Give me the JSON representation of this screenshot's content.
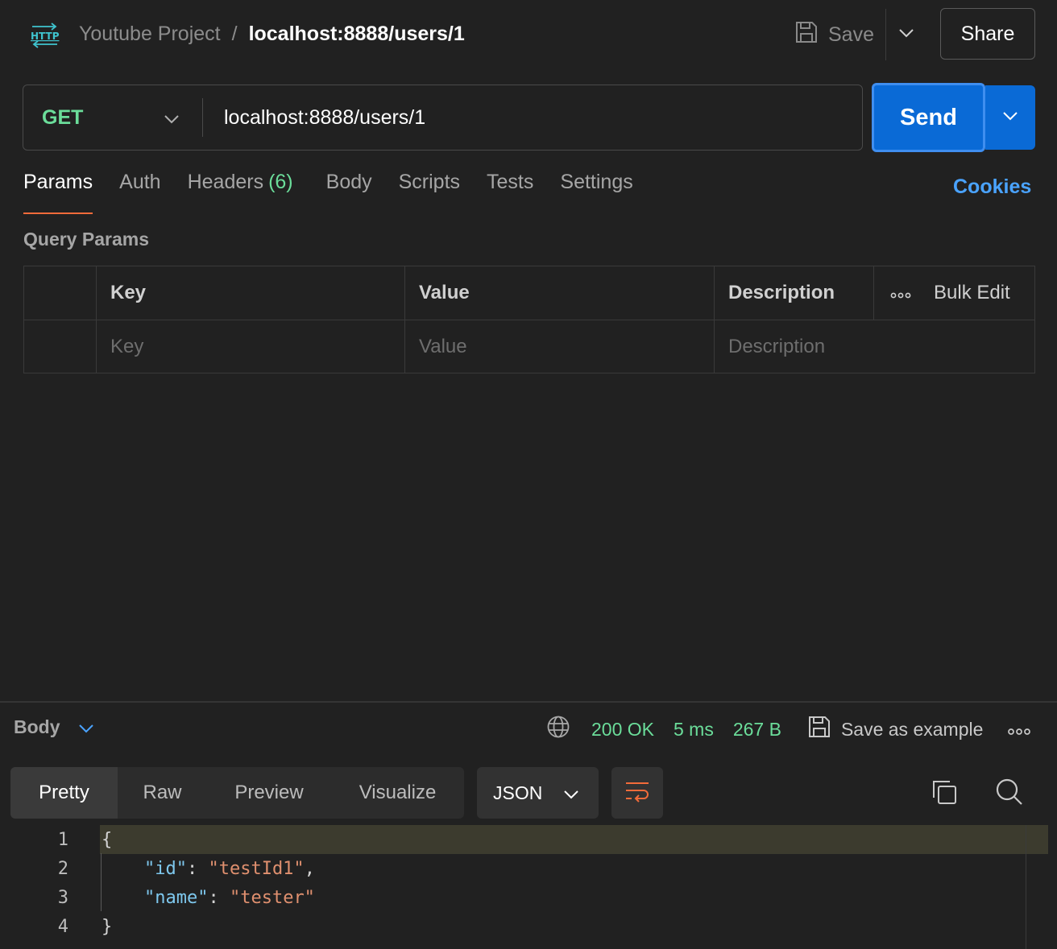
{
  "header": {
    "icon": "http-icon",
    "project": "Youtube Project",
    "separator": "/",
    "request_name": "localhost:8888/users/1",
    "save_label": "Save",
    "share_label": "Share"
  },
  "request": {
    "method": "GET",
    "url": "localhost:8888/users/1",
    "send_label": "Send"
  },
  "tabs": {
    "items": [
      {
        "label": "Params",
        "active": true
      },
      {
        "label": "Auth"
      },
      {
        "label": "Headers",
        "count": "(6)"
      },
      {
        "label": "Body"
      },
      {
        "label": "Scripts"
      },
      {
        "label": "Tests"
      },
      {
        "label": "Settings"
      }
    ],
    "cookies_label": "Cookies"
  },
  "params": {
    "title": "Query Params",
    "columns": {
      "key": "Key",
      "value": "Value",
      "description": "Description"
    },
    "bulk_edit": "Bulk Edit",
    "placeholders": {
      "key": "Key",
      "value": "Value",
      "description": "Description"
    }
  },
  "response": {
    "body_label": "Body",
    "status": "200 OK",
    "time": "5 ms",
    "size": "267 B",
    "save_example": "Save as example",
    "view_tabs": [
      "Pretty",
      "Raw",
      "Preview",
      "Visualize"
    ],
    "active_view": "Pretty",
    "format": "JSON",
    "code": {
      "line_numbers": [
        "1",
        "2",
        "3",
        "4"
      ],
      "open_brace": "{",
      "close_brace": "}",
      "fields": [
        {
          "key": "\"id\"",
          "value": "\"testId1\"",
          "trail": ","
        },
        {
          "key": "\"name\"",
          "value": "\"tester\"",
          "trail": ""
        }
      ]
    }
  },
  "colors": {
    "accent_orange": "#f26b3a",
    "send_blue": "#0a6ad6",
    "method_green": "#6bdd9a",
    "link_blue": "#4aa3ff"
  }
}
